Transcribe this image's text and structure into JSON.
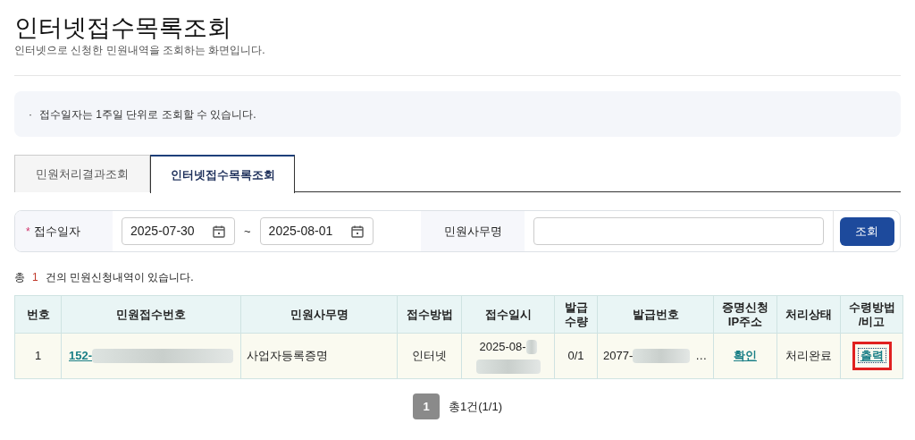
{
  "page": {
    "title": "인터넷접수목록조회",
    "subtitle": "인터넷으로 신청한 민원내역을 조회하는 화면입니다."
  },
  "notice": {
    "bullet": "·",
    "text": "접수일자는 1주일 단위로 조회할 수 있습니다."
  },
  "tabs": [
    {
      "label": "민원처리결과조회",
      "selected": false
    },
    {
      "label": "인터넷접수목록조회",
      "selected": true
    }
  ],
  "search": {
    "date_label": {
      "required_mark": "*",
      "text": "접수일자"
    },
    "date_from": "2025-07-30",
    "separator": "~",
    "date_to": "2025-08-01",
    "name_label": "민원사무명",
    "button": "조회"
  },
  "summary": {
    "prefix": "총",
    "count": "1",
    "suffix": "건의 민원신청내역이 있습니다."
  },
  "table": {
    "columns": [
      "번호",
      "민원접수번호",
      "민원사무명",
      "접수방법",
      "접수일시",
      "발급\n수량",
      "발급번호",
      "증명신청\nIP주소",
      "처리상태",
      "수령방법\n/비고"
    ],
    "rows": [
      {
        "number": "1",
        "receipt_no": "152-",
        "receipt_no_redacted": true,
        "service": "사업자등록증명",
        "method": "인터넷",
        "received_at": "2025-08-",
        "received_at_redacted": true,
        "quantity": "0/1",
        "issue_no": "2077-",
        "issue_no_redacted": true,
        "issue_no_ellipsis": "…",
        "ip": "확인",
        "status": "처리완료",
        "receive": "출력",
        "receive_highlighted": true
      }
    ]
  },
  "pagination": {
    "pages": [
      {
        "label": "1",
        "selected": true
      }
    ],
    "total": "총1건(1/1)"
  }
}
